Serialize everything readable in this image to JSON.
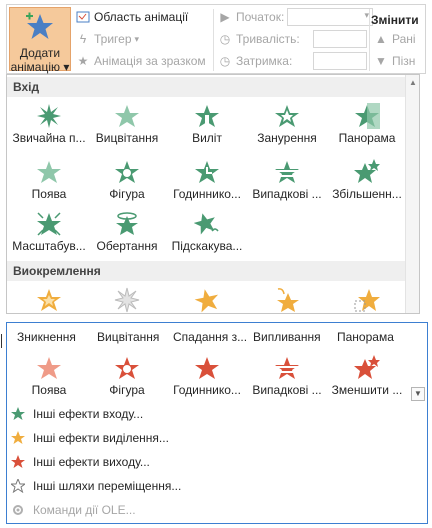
{
  "ribbon": {
    "add_animation_line1": "Додати",
    "add_animation_line2": "анімацію",
    "animation_pane": "Область анімації",
    "trigger": "Тригер",
    "animation_painter": "Анімація за зразком",
    "start_label": "Початок:",
    "duration_label": "Тривалість:",
    "delay_label": "Затримка:",
    "reorder_title": "Змінити",
    "move_earlier": "Рані",
    "move_later": "Пізн"
  },
  "entrance": {
    "title": "Вхід",
    "effects": [
      "Звичайна п...",
      "Вицвітання",
      "Виліт",
      "Занурення",
      "Панорама",
      "Поява",
      "Фігура",
      "Годиннико...",
      "Випадкові ...",
      "Збільшенн...",
      "Масштабув...",
      "Обертання",
      "Підскакува..."
    ]
  },
  "emphasis": {
    "title": "Виокремлення"
  },
  "exit_top_labels": [
    "Зникнення",
    "Вицвітання",
    "Спадання з...",
    "Випливання",
    "Панорама"
  ],
  "exit_effects": [
    "Поява",
    "Фігура",
    "Годиннико...",
    "Випадкові ...",
    "Зменшити ..."
  ],
  "more": {
    "entrance": "Інші ефекти входу...",
    "emphasis": "Інші ефекти виділення...",
    "exit": "Інші ефекти виходу...",
    "motion": "Інші шляхи переміщення...",
    "ole": "Команди дії OLE..."
  },
  "colors": {
    "entrance": "#4a9a72",
    "emphasis": "#f0ad3e",
    "exit": "#d9503a",
    "selected_bg": "#f5c99b",
    "focus_border": "#3d7fd1"
  }
}
